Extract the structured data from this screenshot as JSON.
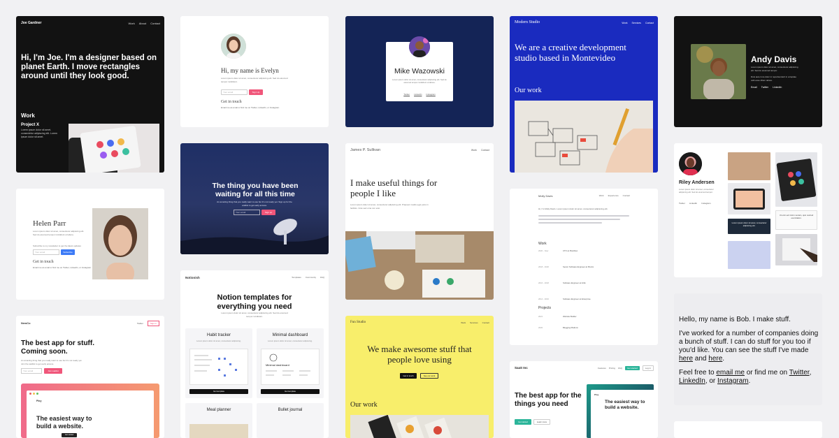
{
  "joe": {
    "brand": "Joe Gardner",
    "nav": [
      "Work",
      "About",
      "Contact"
    ],
    "headline": "Hi, I'm Joe. I'm a designer based on planet Earth. I move rectangles around until they look good.",
    "section": "Work",
    "project_title": "Project X",
    "project_desc": "Lorem ipsum dolor sit amet, consectetur adipiscing elit. Lorem ipsum dolor sit amet."
  },
  "evelyn": {
    "title": "Hi, my name is Evelyn",
    "desc": "Lorem ipsum dolor sit amet, consectetur adipiscing elit. Sed do eiusmod tempor incididunt.",
    "email_placeholder": "Your email",
    "signup": "Sign Up",
    "contact_title": "Get in touch",
    "contact_line": "Email me at email or find me on Twitter, LinkedIn, or Instagram."
  },
  "mike": {
    "name": "Mike Wazowski",
    "desc": "Lorem ipsum dolor sit amet, consectetur adipiscing elit. Sed do eiusmod tempor incididunt ut labore.",
    "links": [
      "Twitter",
      "LinkedIn",
      "Instagram"
    ]
  },
  "modern": {
    "brand": "Modern Studio",
    "nav": [
      "Work",
      "Services",
      "Contact"
    ],
    "headline": "We are a creative development studio based in Montevideo",
    "section": "Our work"
  },
  "andy": {
    "name": "Andy Davis",
    "desc1": "Lorem ipsum dolor sit amet, consectetur adipiscing elit. Sed do eiusmod tempor.",
    "desc2": "Duis aute irure dolor in reprehenderit in voluptate velit esse cillum dolore.",
    "links": [
      "Email",
      "Twitter",
      "LinkedIn"
    ]
  },
  "helen": {
    "name": "Helen Parr",
    "desc": "Lorem ipsum dolor sit amet, consectetur adipiscing elit. Sed do eiusmod tempor incididunt ut labore.",
    "subscribe_line": "Subscribe to my newsletter to get the latest updates",
    "email_placeholder": "Your email",
    "subscribe": "Subscribe",
    "contact_title": "Get in touch",
    "contact_line": "Email me at email or find me on Twitter, LinkedIn, or Instagram."
  },
  "waiting": {
    "headline": "The thing you have been waiting for all this time",
    "sub": "An amazing thing that you really want to use but it's not ready yet. Sign up for the waitlist to get early access.",
    "email_placeholder": "Your email",
    "signup": "Sign up"
  },
  "james": {
    "brand": "James P. Sullivan",
    "nav": [
      "Work",
      "Contact"
    ],
    "headline": "I make useful things for people I like",
    "desc": "Lorem ipsum dolor sit amet, consectetur adipiscing elit. Praesent mattis eget justo in facilisis. Cras sed urna non erat."
  },
  "molly": {
    "brand": "Molly Davis",
    "nav": [
      "Work",
      "Experience",
      "Contact"
    ],
    "intro": "Hi, I'm Molly Davis. Lorem ipsum dolor sit amet, consectetur adipiscing elit.",
    "work_title": "Work",
    "jobs": [
      {
        "date": "2020 - Now",
        "title": "CTO at Plantflow"
      },
      {
        "date": "2018 - 2020",
        "title": "Senior Software Engineer at Plentix"
      },
      {
        "date": "2016 - 2018",
        "title": "Software Engineer at ACE"
      },
      {
        "date": "2014 - 2016",
        "title": "Software Engineer at Enterprise"
      }
    ],
    "projects_title": "Projects",
    "projects": [
      {
        "date": "2021",
        "title": "Website Builder"
      },
      {
        "date": "2020",
        "title": "Blogging Platform"
      }
    ]
  },
  "riley": {
    "name": "Riley Andersen",
    "desc": "Lorem ipsum dolor sit amet, consectetur adipiscing elit. Sed do eiusmod tempor.",
    "links": [
      "Twitter",
      "LinkedIn",
      "Instagram"
    ],
    "quote1": "Lorem ipsum dolor sit amet, consectetur adipiscing elit.",
    "quote2": "Ut enim ad minim veniam, quis nostrud exercitation."
  },
  "newco": {
    "brand": "NewCo",
    "nav": [
      "Twitter",
      "Sign in"
    ],
    "headline": "The best app for stuff. Coming soon.",
    "desc": "An amazing thing that you really want to use but it's not ready yet. Join the waitlist to get early access.",
    "email_placeholder": "Your email",
    "cta": "Join waitlist",
    "inner_brand": "Ploy",
    "inner_headline": "The easiest way to build a website.",
    "inner_cta": "Get started"
  },
  "notionish": {
    "brand": "Notionish",
    "nav": [
      "Templates",
      "Community",
      "FAQ"
    ],
    "headline": "Notion templates for everything you need",
    "sub": "Lorem ipsum dolor sit amet, consectetur adipiscing elit. Sed do eiusmod tempor incididunt.",
    "templates": [
      {
        "title": "Habit tracker",
        "desc": "Lorem ipsum dolor sit amet, consectetur adipiscing.",
        "cta": "Get template"
      },
      {
        "title": "Minimal dashboard",
        "desc": "Lorem ipsum dolor sit amet, consectetur adipiscing.",
        "cta": "Get template"
      },
      {
        "title": "Meal planner",
        "desc": "",
        "cta": ""
      },
      {
        "title": "Bullet journal",
        "desc": "",
        "cta": ""
      }
    ],
    "inner_title": "Minimal dashboard"
  },
  "fun": {
    "brand": "Fun Studio",
    "nav": [
      "Work",
      "Services",
      "Contact"
    ],
    "headline": "We make awesome stuff that people love using",
    "cta_primary": "Get in touch",
    "cta_secondary": "See our work",
    "section": "Our work"
  },
  "saas": {
    "brand": "SaaS Inc",
    "nav": [
      "Features",
      "Pricing",
      "FAQ"
    ],
    "nav_cta": "Get started",
    "nav_login": "Log in",
    "headline": "The best app for the things you need",
    "cta_primary": "Get started",
    "cta_secondary": "Learn more",
    "inner_brand": "Ploy",
    "inner_headline": "The easiest way to build a website."
  },
  "bob": {
    "line1": "Hello, my name is Bob. I make stuff.",
    "para_pre": "I've worked for a number of companies doing a bunch of stuff. I can do stuff for you too if you'd like. You can see the stuff I've made ",
    "link_here1": "here",
    "and": " and ",
    "link_here2": "here",
    "period": ".",
    "contact_pre": "Feel free to ",
    "link_email": "email me",
    "contact_mid": " or find me on ",
    "link_twitter": "Twitter",
    "comma": ", ",
    "link_linkedin": "LinkedIn",
    "or": ", or ",
    "link_instagram": "Instagram"
  },
  "colors": {
    "bg": "#f1f1f3",
    "pink": "#f0567a",
    "blue_modern": "#1a2bbf",
    "navy": "#142456",
    "yellow": "#f8ee6b",
    "teal": "#2cb59a",
    "blue_btn": "#3d7bf6"
  }
}
